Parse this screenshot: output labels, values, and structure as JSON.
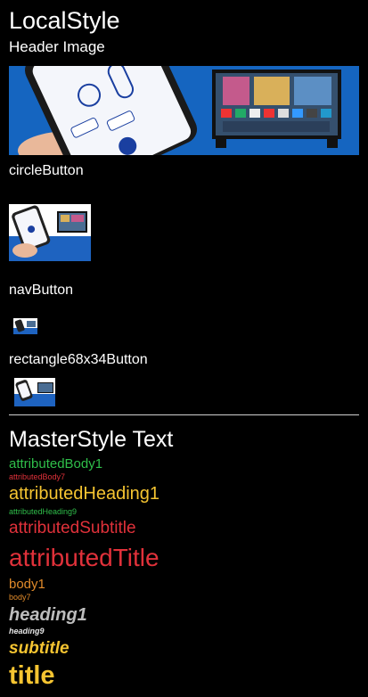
{
  "local": {
    "title": "LocalStyle",
    "header_image_label": "Header Image",
    "circle_button_label": "circleButton",
    "nav_button_label": "navButton",
    "rect_button_label": "rectangle68x34Button"
  },
  "master": {
    "title": "MasterStyle Text",
    "items": [
      {
        "label": "attributedBody1"
      },
      {
        "label": "attributedBody7"
      },
      {
        "label": "attributedHeading1"
      },
      {
        "label": "attributedHeading9"
      },
      {
        "label": "attributedSubtitle"
      },
      {
        "label": "attributedTitle"
      },
      {
        "label": "body1"
      },
      {
        "label": "body7"
      },
      {
        "label": "heading1"
      },
      {
        "label": "heading9"
      },
      {
        "label": "subtitle"
      },
      {
        "label": "title"
      }
    ]
  },
  "colors": {
    "background": "#000000",
    "green": "#2fbf4a",
    "red": "#e0313a",
    "yellow": "#f5c431",
    "orange": "#e08a2a",
    "gray": "#bdbdbd",
    "banner_blue": "#1565c0"
  }
}
